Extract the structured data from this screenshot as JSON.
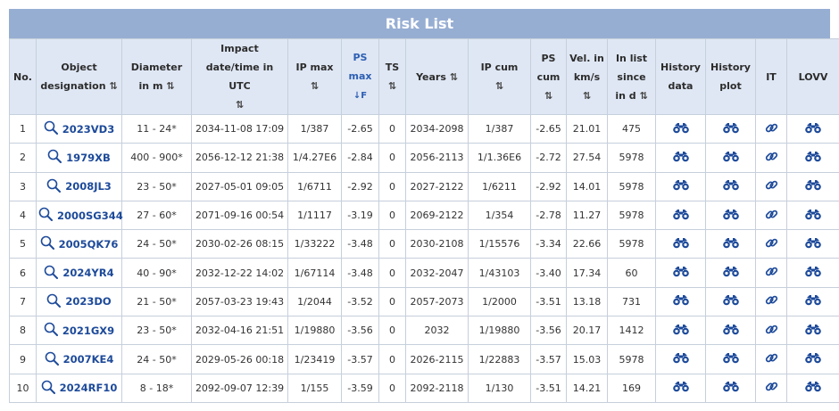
{
  "title": "Risk List",
  "headers": {
    "no": "No.",
    "object": "Object designation",
    "diameter": "Diameter in m",
    "impact": "Impact date/time in UTC",
    "ipmax": "IP max",
    "psmax": "PS max",
    "ts": "TS",
    "years": "Years",
    "ipcum": "IP cum",
    "pscum": "PS cum",
    "vel": "Vel. in km/s",
    "inlist": "In list since in d",
    "histdata": "History data",
    "histplot": "History plot",
    "it": "IT",
    "lovv": "LOVV"
  },
  "sort_icon": "⇅",
  "sort_active_icon": "↓F",
  "icons": {
    "search": "magnifier-icon",
    "binoculars": "binoculars-icon",
    "link": "link-icon"
  },
  "colors": {
    "title_bg": "#97aed3",
    "header_bg": "#dfe7f4",
    "link": "#1d4a9a",
    "accent": "#2d5fb3"
  },
  "rows": [
    {
      "no": "1",
      "obj": "2023VD3",
      "dia": "11 - 24*",
      "impact": "2034-11-08 17:09",
      "ipmax": "1/387",
      "psmax": "-2.65",
      "ts": "0",
      "years": "2034-2098",
      "ipcum": "1/387",
      "pscum": "-2.65",
      "vel": "21.01",
      "inlist": "475"
    },
    {
      "no": "2",
      "obj": "1979XB",
      "dia": "400 - 900*",
      "impact": "2056-12-12 21:38",
      "ipmax": "1/4.27E6",
      "psmax": "-2.84",
      "ts": "0",
      "years": "2056-2113",
      "ipcum": "1/1.36E6",
      "pscum": "-2.72",
      "vel": "27.54",
      "inlist": "5978"
    },
    {
      "no": "3",
      "obj": "2008JL3",
      "dia": "23 - 50*",
      "impact": "2027-05-01 09:05",
      "ipmax": "1/6711",
      "psmax": "-2.92",
      "ts": "0",
      "years": "2027-2122",
      "ipcum": "1/6211",
      "pscum": "-2.92",
      "vel": "14.01",
      "inlist": "5978"
    },
    {
      "no": "4",
      "obj": "2000SG344",
      "dia": "27 - 60*",
      "impact": "2071-09-16 00:54",
      "ipmax": "1/1117",
      "psmax": "-3.19",
      "ts": "0",
      "years": "2069-2122",
      "ipcum": "1/354",
      "pscum": "-2.78",
      "vel": "11.27",
      "inlist": "5978"
    },
    {
      "no": "5",
      "obj": "2005QK76",
      "dia": "24 - 50*",
      "impact": "2030-02-26 08:15",
      "ipmax": "1/33222",
      "psmax": "-3.48",
      "ts": "0",
      "years": "2030-2108",
      "ipcum": "1/15576",
      "pscum": "-3.34",
      "vel": "22.66",
      "inlist": "5978"
    },
    {
      "no": "6",
      "obj": "2024YR4",
      "dia": "40 - 90*",
      "impact": "2032-12-22 14:02",
      "ipmax": "1/67114",
      "psmax": "-3.48",
      "ts": "0",
      "years": "2032-2047",
      "ipcum": "1/43103",
      "pscum": "-3.40",
      "vel": "17.34",
      "inlist": "60"
    },
    {
      "no": "7",
      "obj": "2023DO",
      "dia": "21 - 50*",
      "impact": "2057-03-23 19:43",
      "ipmax": "1/2044",
      "psmax": "-3.52",
      "ts": "0",
      "years": "2057-2073",
      "ipcum": "1/2000",
      "pscum": "-3.51",
      "vel": "13.18",
      "inlist": "731"
    },
    {
      "no": "8",
      "obj": "2021GX9",
      "dia": "23 - 50*",
      "impact": "2032-04-16 21:51",
      "ipmax": "1/19880",
      "psmax": "-3.56",
      "ts": "0",
      "years": "2032",
      "ipcum": "1/19880",
      "pscum": "-3.56",
      "vel": "20.17",
      "inlist": "1412"
    },
    {
      "no": "9",
      "obj": "2007KE4",
      "dia": "24 - 50*",
      "impact": "2029-05-26 00:18",
      "ipmax": "1/23419",
      "psmax": "-3.57",
      "ts": "0",
      "years": "2026-2115",
      "ipcum": "1/22883",
      "pscum": "-3.57",
      "vel": "15.03",
      "inlist": "5978"
    },
    {
      "no": "10",
      "obj": "2024RF10",
      "dia": "8 - 18*",
      "impact": "2092-09-07 12:39",
      "ipmax": "1/155",
      "psmax": "-3.59",
      "ts": "0",
      "years": "2092-2118",
      "ipcum": "1/130",
      "pscum": "-3.51",
      "vel": "14.21",
      "inlist": "169"
    }
  ]
}
